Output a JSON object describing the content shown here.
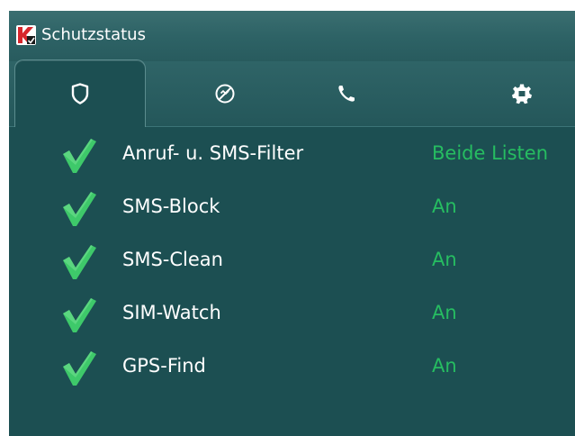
{
  "window": {
    "title": "Schutzstatus"
  },
  "tabs": [
    {
      "name": "shield-icon",
      "active": true
    },
    {
      "name": "blocked-icon",
      "active": false
    },
    {
      "name": "phone-icon",
      "active": false
    },
    {
      "name": "gear-icon",
      "active": false
    }
  ],
  "features": [
    {
      "label": "Anruf- u. SMS-Filter",
      "status": "Beide Listen"
    },
    {
      "label": "SMS-Block",
      "status": "An"
    },
    {
      "label": "SMS-Clean",
      "status": "An"
    },
    {
      "label": "SIM-Watch",
      "status": "An"
    },
    {
      "label": "GPS-Find",
      "status": "An"
    }
  ],
  "colors": {
    "background": "#1c4f52",
    "status_text": "#26bd61",
    "check": "#3ec96a"
  }
}
